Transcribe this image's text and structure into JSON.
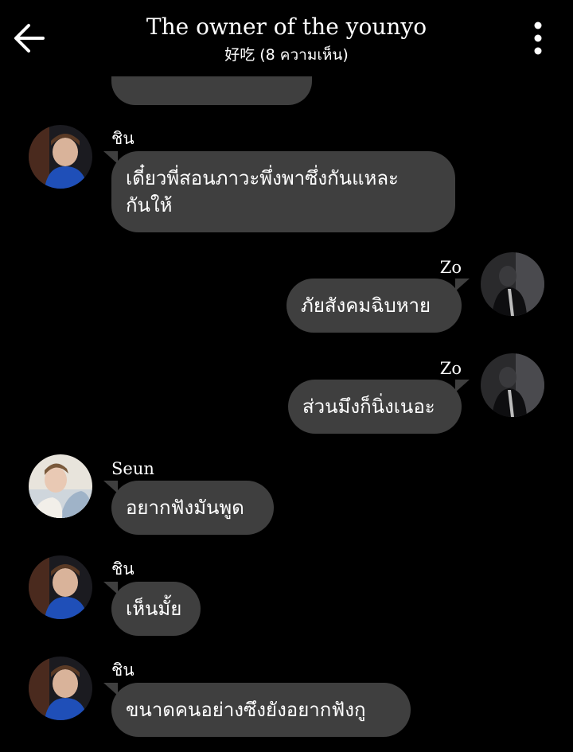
{
  "header": {
    "title": "The owner of the younyo",
    "subtitle": "好吃 (8 ความเห็น)",
    "back_icon": "arrow-left-icon",
    "menu_icon": "more-vertical-icon"
  },
  "colors": {
    "background": "#000000",
    "bubble": "#3f3f3f",
    "text": "#ffffff"
  },
  "messages": [
    {
      "sender": "ชิน",
      "side": "left",
      "lines": [
        "เดี๋ยวพี่สอนภาวะพึ่งพาซึ่งกันแหละ",
        "กันให้"
      ]
    },
    {
      "sender": "Zo",
      "side": "right",
      "lines": [
        "ภัยสังคมฉิบหาย"
      ]
    },
    {
      "sender": "Zo",
      "side": "right",
      "lines": [
        "ส่วนมึงก็นิ่งเนอะ"
      ]
    },
    {
      "sender": "Seun",
      "side": "left",
      "lines": [
        "อยากฟังมันพูด"
      ]
    },
    {
      "sender": "ชิน",
      "side": "left",
      "lines": [
        "เห็นมั้ย"
      ]
    },
    {
      "sender": "ชิน",
      "side": "left",
      "lines": [
        "ขนาดคนอย่างซึงยังอยากฟังกู"
      ]
    }
  ]
}
